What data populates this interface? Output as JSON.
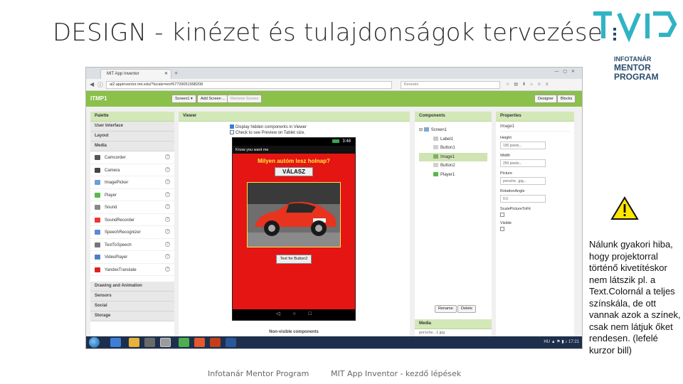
{
  "slide": {
    "title": "DESIGN - kinézet és tulajdonságok tervezése",
    "logo_lines": [
      "INFOTANÁR",
      "MENTOR",
      "PROGRAM"
    ],
    "note": "Nálunk gyakori hiba, hogy projektorral történő kivetítéskor nem látszik pl. a Text.Colornál a teljes színskála, de ott vannak azok a színek, csak nem látjuk őket rendesen. (lefelé kurzor bill)",
    "footer_left": "Infotanár Mentor Program",
    "footer_right": "MIT App Inventor - kezdő lépések",
    "brand_color": "#2a4d6c",
    "accent_color": "#30b4c5"
  },
  "browser": {
    "tab_title": "MIT App Inventor",
    "url": "ai2.appinventor.mit.edu/?locale=en#57739051998208",
    "search_placeholder": "Keresés"
  },
  "app": {
    "project_name": "ITMP1",
    "screen_button": "Screen1 ▾",
    "add_screen": "Add Screen ...",
    "remove_screen": "Remove Screen",
    "designer": "Designer",
    "blocks": "Blocks",
    "bar_color": "#8bc04a"
  },
  "palette": {
    "header": "Palette",
    "categories_top": [
      "User Interface",
      "Layout",
      "Media"
    ],
    "media_items": [
      {
        "label": "Camcorder",
        "icon": "camcorder-icon"
      },
      {
        "label": "Camera",
        "icon": "camera-icon"
      },
      {
        "label": "ImagePicker",
        "icon": "image-picker-icon"
      },
      {
        "label": "Player",
        "icon": "player-icon"
      },
      {
        "label": "Sound",
        "icon": "sound-icon"
      },
      {
        "label": "SoundRecorder",
        "icon": "sound-recorder-icon"
      },
      {
        "label": "SpeechRecognizer",
        "icon": "speech-recognizer-icon"
      },
      {
        "label": "TextToSpeech",
        "icon": "text-to-speech-icon"
      },
      {
        "label": "VideoPlayer",
        "icon": "video-player-icon"
      },
      {
        "label": "YandexTranslate",
        "icon": "yandex-translate-icon"
      }
    ],
    "categories_bottom": [
      "Drawing and Animation",
      "Sensors",
      "Social",
      "Storage"
    ]
  },
  "viewer": {
    "header": "Viewer",
    "opt_hidden": "Display hidden components in Viewer",
    "opt_tablet": "Check to see Preview on Tablet size.",
    "phone_time": "3:48",
    "phone_title": "Know you want me",
    "label_text": "Milyen autóm lesz holnap?",
    "button1_text": "VÁLASZ",
    "button2_text": "Text for Button2",
    "nonvisible": "Non-visible components",
    "phone_color": "#e41512",
    "label_color": "#ffeb3b"
  },
  "components": {
    "header": "Components",
    "root": "Screen1",
    "items": [
      "Label1",
      "Button1",
      "Image1",
      "Button2",
      "Player1"
    ],
    "selected": "Image1",
    "rename": "Rename",
    "delete": "Delete",
    "media_header": "Media",
    "media_file": "porsche...1.jpg"
  },
  "properties": {
    "header": "Properties",
    "component": "Image1",
    "height_label": "Height",
    "height_value": "190 pixels...",
    "width_label": "Width",
    "width_value": "250 pixels...",
    "picture_label": "Picture",
    "picture_value": "porsche...jpg...",
    "rotation_label": "RotationAngle",
    "rotation_value": "0.0",
    "scale_label": "ScalePictureToFit",
    "visible_label": "Visible"
  },
  "taskbar": {
    "lang": "HU",
    "time": "17:21"
  }
}
